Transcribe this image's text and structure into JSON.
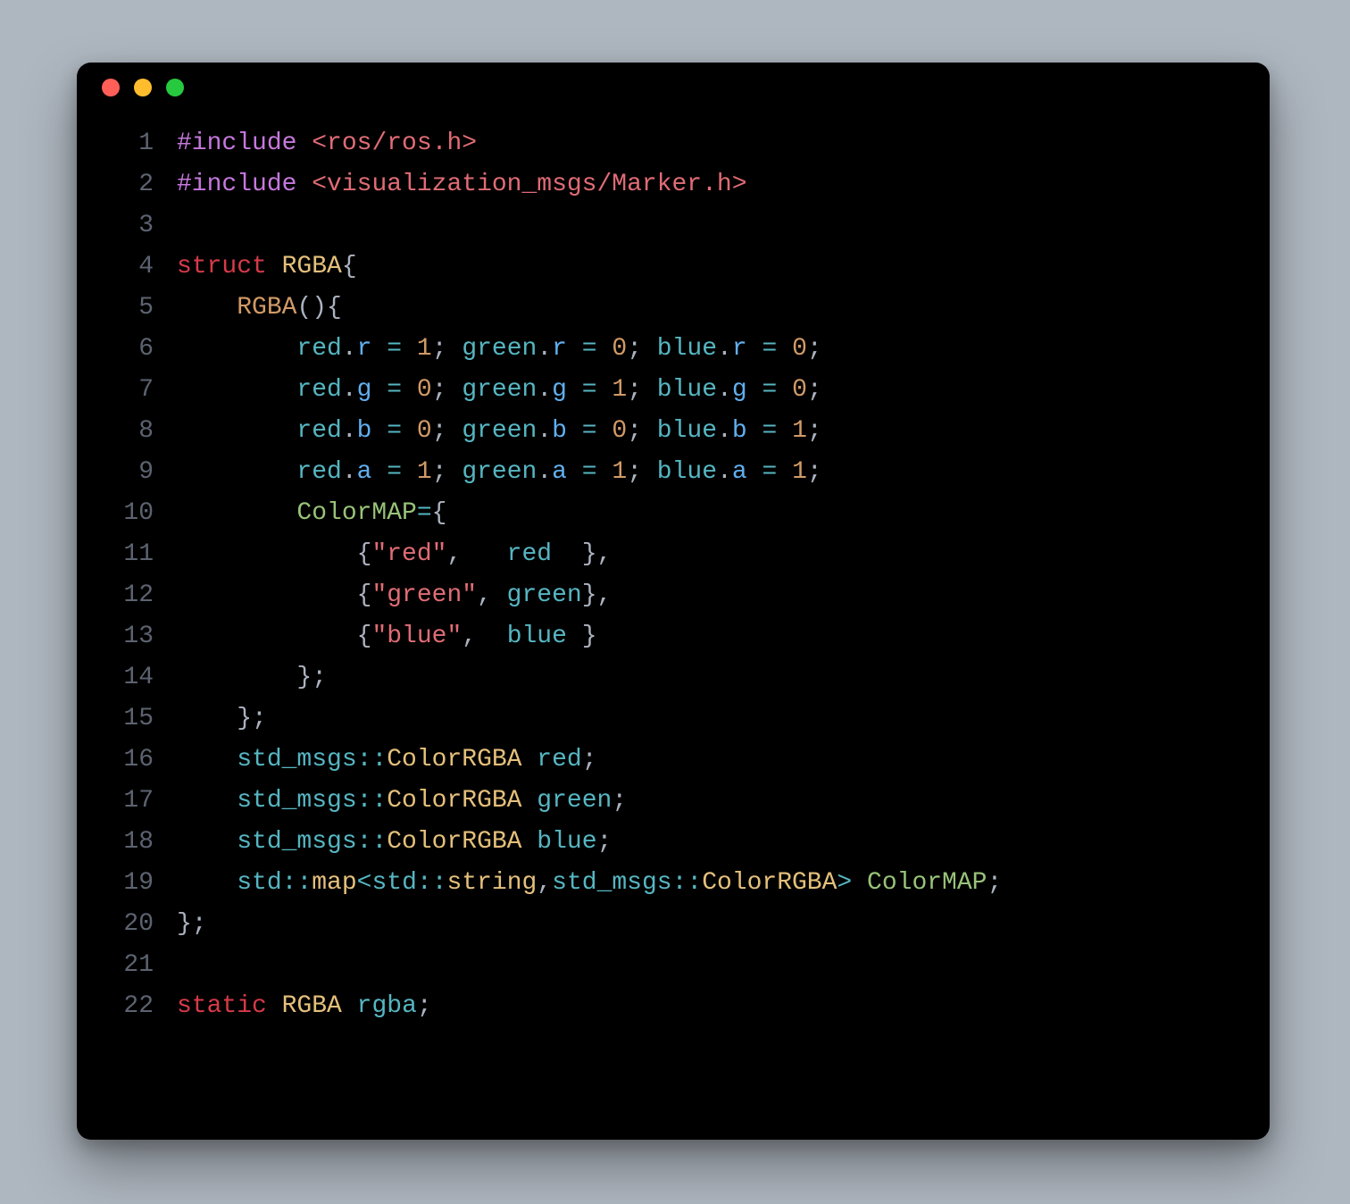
{
  "window": {
    "buttons": [
      "close",
      "minimize",
      "zoom"
    ]
  },
  "code": {
    "lines": [
      {
        "n": "1",
        "tokens": [
          {
            "t": "#include ",
            "c": "kw"
          },
          {
            "t": "<ros/ros.h>",
            "c": "hdr"
          }
        ]
      },
      {
        "n": "2",
        "tokens": [
          {
            "t": "#include ",
            "c": "kw"
          },
          {
            "t": "<visualization_msgs/Marker.h>",
            "c": "hdr"
          }
        ]
      },
      {
        "n": "3",
        "tokens": [
          {
            "t": "",
            "c": "punc"
          }
        ]
      },
      {
        "n": "4",
        "tokens": [
          {
            "t": "struct ",
            "c": "kw2"
          },
          {
            "t": "RGBA",
            "c": "type"
          },
          {
            "t": "{",
            "c": "punc"
          }
        ]
      },
      {
        "n": "5",
        "tokens": [
          {
            "t": "    ",
            "c": "punc"
          },
          {
            "t": "RGBA",
            "c": "fn"
          },
          {
            "t": "(){",
            "c": "punc"
          }
        ]
      },
      {
        "n": "6",
        "tokens": [
          {
            "t": "        ",
            "c": "punc"
          },
          {
            "t": "red",
            "c": "id"
          },
          {
            "t": ".",
            "c": "punc"
          },
          {
            "t": "r",
            "c": "mem"
          },
          {
            "t": " = ",
            "c": "op"
          },
          {
            "t": "1",
            "c": "num"
          },
          {
            "t": "; ",
            "c": "punc"
          },
          {
            "t": "green",
            "c": "id"
          },
          {
            "t": ".",
            "c": "punc"
          },
          {
            "t": "r",
            "c": "mem"
          },
          {
            "t": " = ",
            "c": "op"
          },
          {
            "t": "0",
            "c": "num"
          },
          {
            "t": "; ",
            "c": "punc"
          },
          {
            "t": "blue",
            "c": "id"
          },
          {
            "t": ".",
            "c": "punc"
          },
          {
            "t": "r",
            "c": "mem"
          },
          {
            "t": " = ",
            "c": "op"
          },
          {
            "t": "0",
            "c": "num"
          },
          {
            "t": ";",
            "c": "punc"
          }
        ]
      },
      {
        "n": "7",
        "tokens": [
          {
            "t": "        ",
            "c": "punc"
          },
          {
            "t": "red",
            "c": "id"
          },
          {
            "t": ".",
            "c": "punc"
          },
          {
            "t": "g",
            "c": "mem"
          },
          {
            "t": " = ",
            "c": "op"
          },
          {
            "t": "0",
            "c": "num"
          },
          {
            "t": "; ",
            "c": "punc"
          },
          {
            "t": "green",
            "c": "id"
          },
          {
            "t": ".",
            "c": "punc"
          },
          {
            "t": "g",
            "c": "mem"
          },
          {
            "t": " = ",
            "c": "op"
          },
          {
            "t": "1",
            "c": "num"
          },
          {
            "t": "; ",
            "c": "punc"
          },
          {
            "t": "blue",
            "c": "id"
          },
          {
            "t": ".",
            "c": "punc"
          },
          {
            "t": "g",
            "c": "mem"
          },
          {
            "t": " = ",
            "c": "op"
          },
          {
            "t": "0",
            "c": "num"
          },
          {
            "t": ";",
            "c": "punc"
          }
        ]
      },
      {
        "n": "8",
        "tokens": [
          {
            "t": "        ",
            "c": "punc"
          },
          {
            "t": "red",
            "c": "id"
          },
          {
            "t": ".",
            "c": "punc"
          },
          {
            "t": "b",
            "c": "mem"
          },
          {
            "t": " = ",
            "c": "op"
          },
          {
            "t": "0",
            "c": "num"
          },
          {
            "t": "; ",
            "c": "punc"
          },
          {
            "t": "green",
            "c": "id"
          },
          {
            "t": ".",
            "c": "punc"
          },
          {
            "t": "b",
            "c": "mem"
          },
          {
            "t": " = ",
            "c": "op"
          },
          {
            "t": "0",
            "c": "num"
          },
          {
            "t": "; ",
            "c": "punc"
          },
          {
            "t": "blue",
            "c": "id"
          },
          {
            "t": ".",
            "c": "punc"
          },
          {
            "t": "b",
            "c": "mem"
          },
          {
            "t": " = ",
            "c": "op"
          },
          {
            "t": "1",
            "c": "num"
          },
          {
            "t": ";",
            "c": "punc"
          }
        ]
      },
      {
        "n": "9",
        "tokens": [
          {
            "t": "        ",
            "c": "punc"
          },
          {
            "t": "red",
            "c": "id"
          },
          {
            "t": ".",
            "c": "punc"
          },
          {
            "t": "a",
            "c": "mem"
          },
          {
            "t": " = ",
            "c": "op"
          },
          {
            "t": "1",
            "c": "num"
          },
          {
            "t": "; ",
            "c": "punc"
          },
          {
            "t": "green",
            "c": "id"
          },
          {
            "t": ".",
            "c": "punc"
          },
          {
            "t": "a",
            "c": "mem"
          },
          {
            "t": " = ",
            "c": "op"
          },
          {
            "t": "1",
            "c": "num"
          },
          {
            "t": "; ",
            "c": "punc"
          },
          {
            "t": "blue",
            "c": "id"
          },
          {
            "t": ".",
            "c": "punc"
          },
          {
            "t": "a",
            "c": "mem"
          },
          {
            "t": " = ",
            "c": "op"
          },
          {
            "t": "1",
            "c": "num"
          },
          {
            "t": ";",
            "c": "punc"
          }
        ]
      },
      {
        "n": "10",
        "tokens": [
          {
            "t": "        ",
            "c": "punc"
          },
          {
            "t": "ColorMAP",
            "c": "greenid"
          },
          {
            "t": "=",
            "c": "op"
          },
          {
            "t": "{",
            "c": "punc"
          }
        ]
      },
      {
        "n": "11",
        "tokens": [
          {
            "t": "            {",
            "c": "punc"
          },
          {
            "t": "\"red\"",
            "c": "strQ"
          },
          {
            "t": ",   ",
            "c": "punc"
          },
          {
            "t": "red",
            "c": "id"
          },
          {
            "t": "  },",
            "c": "punc"
          }
        ]
      },
      {
        "n": "12",
        "tokens": [
          {
            "t": "            {",
            "c": "punc"
          },
          {
            "t": "\"green\"",
            "c": "strQ"
          },
          {
            "t": ", ",
            "c": "punc"
          },
          {
            "t": "green",
            "c": "id"
          },
          {
            "t": "},",
            "c": "punc"
          }
        ]
      },
      {
        "n": "13",
        "tokens": [
          {
            "t": "            {",
            "c": "punc"
          },
          {
            "t": "\"blue\"",
            "c": "strQ"
          },
          {
            "t": ",  ",
            "c": "punc"
          },
          {
            "t": "blue",
            "c": "id"
          },
          {
            "t": " }",
            "c": "punc"
          }
        ]
      },
      {
        "n": "14",
        "tokens": [
          {
            "t": "        };",
            "c": "punc"
          }
        ]
      },
      {
        "n": "15",
        "tokens": [
          {
            "t": "    };",
            "c": "punc"
          }
        ]
      },
      {
        "n": "16",
        "tokens": [
          {
            "t": "    ",
            "c": "punc"
          },
          {
            "t": "std_msgs",
            "c": "ns"
          },
          {
            "t": "::",
            "c": "op"
          },
          {
            "t": "ColorRGBA",
            "c": "type"
          },
          {
            "t": " ",
            "c": "punc"
          },
          {
            "t": "red",
            "c": "id"
          },
          {
            "t": ";",
            "c": "punc"
          }
        ]
      },
      {
        "n": "17",
        "tokens": [
          {
            "t": "    ",
            "c": "punc"
          },
          {
            "t": "std_msgs",
            "c": "ns"
          },
          {
            "t": "::",
            "c": "op"
          },
          {
            "t": "ColorRGBA",
            "c": "type"
          },
          {
            "t": " ",
            "c": "punc"
          },
          {
            "t": "green",
            "c": "id"
          },
          {
            "t": ";",
            "c": "punc"
          }
        ]
      },
      {
        "n": "18",
        "tokens": [
          {
            "t": "    ",
            "c": "punc"
          },
          {
            "t": "std_msgs",
            "c": "ns"
          },
          {
            "t": "::",
            "c": "op"
          },
          {
            "t": "ColorRGBA",
            "c": "type"
          },
          {
            "t": " ",
            "c": "punc"
          },
          {
            "t": "blue",
            "c": "id"
          },
          {
            "t": ";",
            "c": "punc"
          }
        ]
      },
      {
        "n": "19",
        "tokens": [
          {
            "t": "    ",
            "c": "punc"
          },
          {
            "t": "std",
            "c": "ns"
          },
          {
            "t": "::",
            "c": "op"
          },
          {
            "t": "map",
            "c": "type"
          },
          {
            "t": "<",
            "c": "op"
          },
          {
            "t": "std",
            "c": "ns"
          },
          {
            "t": "::",
            "c": "op"
          },
          {
            "t": "string",
            "c": "type"
          },
          {
            "t": ",",
            "c": "punc"
          },
          {
            "t": "std_msgs",
            "c": "ns"
          },
          {
            "t": "::",
            "c": "op"
          },
          {
            "t": "ColorRGBA",
            "c": "type"
          },
          {
            "t": ">",
            "c": "op"
          },
          {
            "t": " ",
            "c": "punc"
          },
          {
            "t": "ColorMAP",
            "c": "greenid"
          },
          {
            "t": ";",
            "c": "punc"
          }
        ]
      },
      {
        "n": "20",
        "tokens": [
          {
            "t": "};",
            "c": "punc"
          }
        ]
      },
      {
        "n": "21",
        "tokens": [
          {
            "t": "",
            "c": "punc"
          }
        ]
      },
      {
        "n": "22",
        "tokens": [
          {
            "t": "static ",
            "c": "kw2"
          },
          {
            "t": "RGBA",
            "c": "type"
          },
          {
            "t": " ",
            "c": "punc"
          },
          {
            "t": "rgba",
            "c": "id"
          },
          {
            "t": ";",
            "c": "punc"
          }
        ]
      }
    ]
  }
}
